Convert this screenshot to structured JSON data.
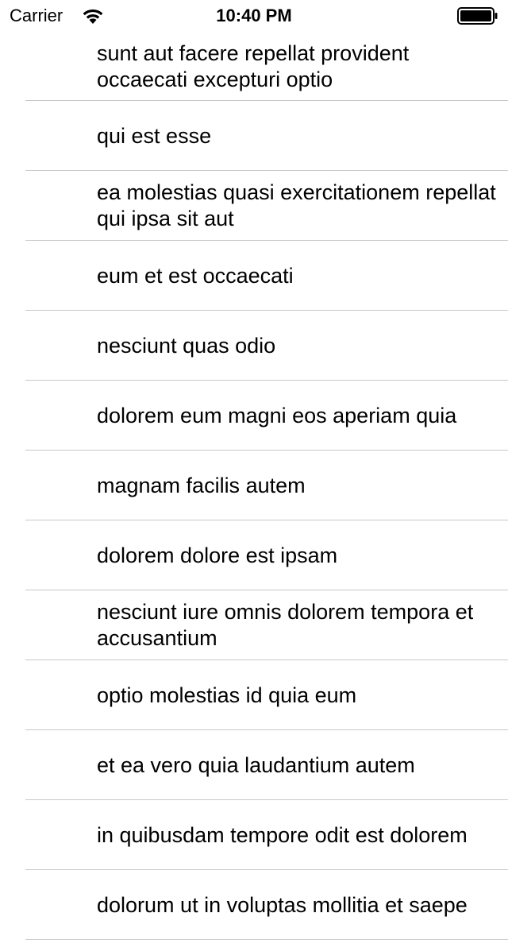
{
  "status_bar": {
    "carrier": "Carrier",
    "time": "10:40 PM",
    "wifi_icon": "wifi-icon",
    "battery_icon": "battery-icon"
  },
  "list": {
    "items": [
      {
        "title": "sunt aut facere repellat provident occaecati excepturi optio"
      },
      {
        "title": "qui est esse"
      },
      {
        "title": "ea molestias quasi exercitationem repellat qui ipsa sit aut"
      },
      {
        "title": "eum et est occaecati"
      },
      {
        "title": "nesciunt quas odio"
      },
      {
        "title": "dolorem eum magni eos aperiam quia"
      },
      {
        "title": "magnam facilis autem"
      },
      {
        "title": "dolorem dolore est ipsam"
      },
      {
        "title": "nesciunt iure omnis dolorem tempora et accusantium"
      },
      {
        "title": "optio molestias id quia eum"
      },
      {
        "title": "et ea vero quia laudantium autem"
      },
      {
        "title": "in quibusdam tempore odit est dolorem"
      },
      {
        "title": "dolorum ut in voluptas mollitia et saepe"
      }
    ]
  }
}
